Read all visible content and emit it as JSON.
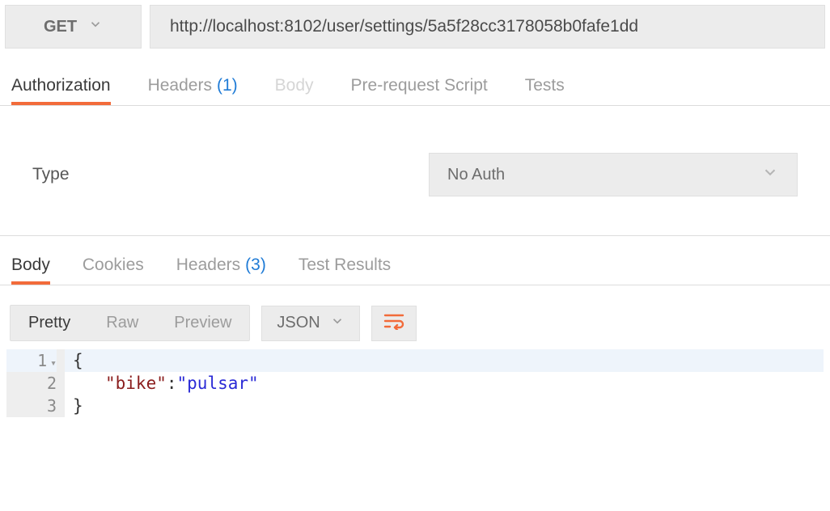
{
  "request": {
    "method": "GET",
    "url": "http://localhost:8102/user/settings/5a5f28cc3178058b0fafe1dd",
    "tabs": {
      "authorization": "Authorization",
      "headers": "Headers",
      "headers_count": "(1)",
      "body": "Body",
      "prerequest": "Pre-request Script",
      "tests": "Tests"
    },
    "auth": {
      "type_label": "Type",
      "selected": "No Auth"
    }
  },
  "response": {
    "tabs": {
      "body": "Body",
      "cookies": "Cookies",
      "headers": "Headers",
      "headers_count": "(3)",
      "test_results": "Test Results"
    },
    "view_modes": {
      "pretty": "Pretty",
      "raw": "Raw",
      "preview": "Preview"
    },
    "format_selected": "JSON",
    "body_lines": {
      "l1_num": "1",
      "l2_num": "2",
      "l3_num": "3",
      "brace_open": "{",
      "brace_close": "}",
      "key": "\"bike\"",
      "colon_space": ": ",
      "value": "\"pulsar\""
    }
  }
}
